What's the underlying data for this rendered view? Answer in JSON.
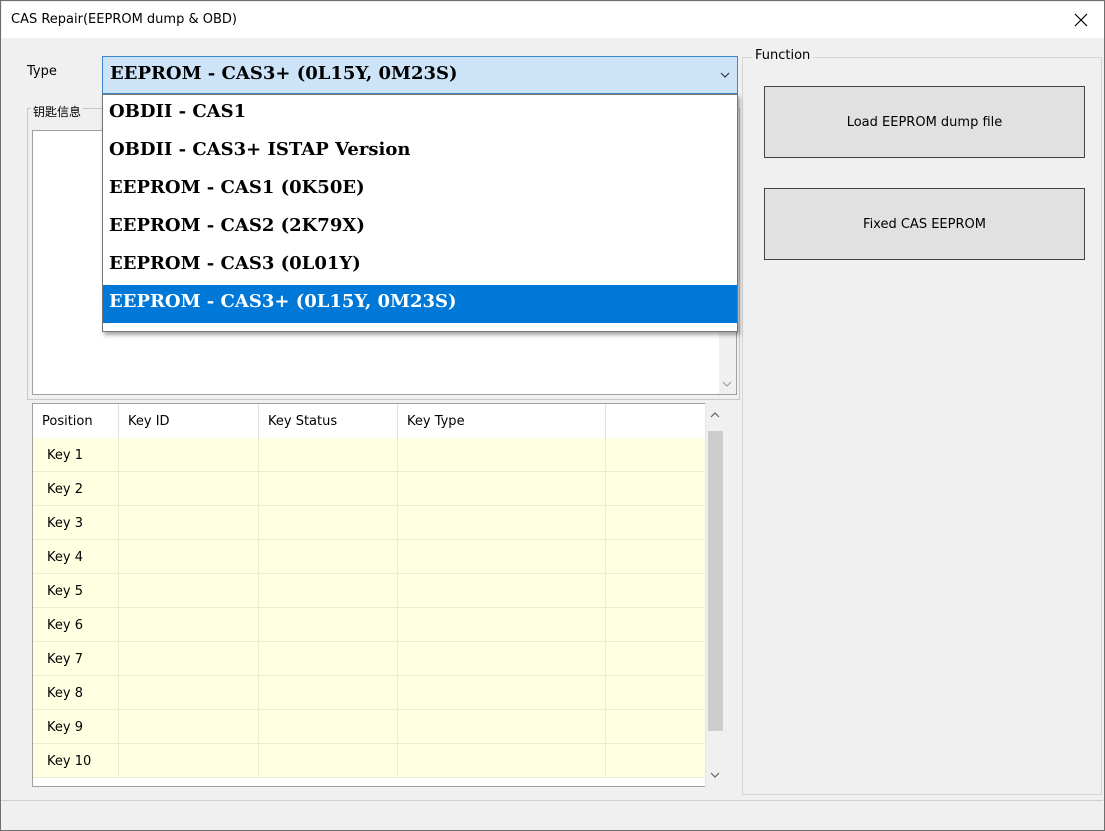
{
  "window": {
    "title": "CAS Repair(EEPROM dump & OBD)"
  },
  "type_selector": {
    "label": "Type",
    "selected": "EEPROM - CAS3+ (0L15Y, 0M23S)",
    "options": [
      "OBDII - CAS1",
      "OBDII - CAS3+ ISTAP Version",
      "EEPROM - CAS1 (0K50E)",
      "EEPROM - CAS2 (2K79X)",
      "EEPROM - CAS3 (0L01Y)",
      "EEPROM - CAS3+ (0L15Y, 0M23S)"
    ],
    "selected_index": 5
  },
  "key_info": {
    "label": "钥匙信息",
    "text": ""
  },
  "key_table": {
    "columns": [
      "Position",
      "Key ID",
      "Key Status",
      "Key Type"
    ],
    "rows": [
      [
        "Key 1",
        "",
        "",
        ""
      ],
      [
        "Key 2",
        "",
        "",
        ""
      ],
      [
        "Key 3",
        "",
        "",
        ""
      ],
      [
        "Key 4",
        "",
        "",
        ""
      ],
      [
        "Key 5",
        "",
        "",
        ""
      ],
      [
        "Key 6",
        "",
        "",
        ""
      ],
      [
        "Key 7",
        "",
        "",
        ""
      ],
      [
        "Key 8",
        "",
        "",
        ""
      ],
      [
        "Key 9",
        "",
        "",
        ""
      ],
      [
        "Key 10",
        "",
        "",
        ""
      ]
    ]
  },
  "function_panel": {
    "label": "Function",
    "buttons": [
      "Load EEPROM dump file",
      "Fixed CAS EEPROM"
    ]
  },
  "status_bar": {
    "text": ""
  },
  "colors": {
    "selection": "#0078d7",
    "combo_bg": "#cde3f7",
    "row_bg": "#ffffe1"
  },
  "icons": {
    "close": "close-icon",
    "combo_arrow": "chevron-down-icon"
  }
}
